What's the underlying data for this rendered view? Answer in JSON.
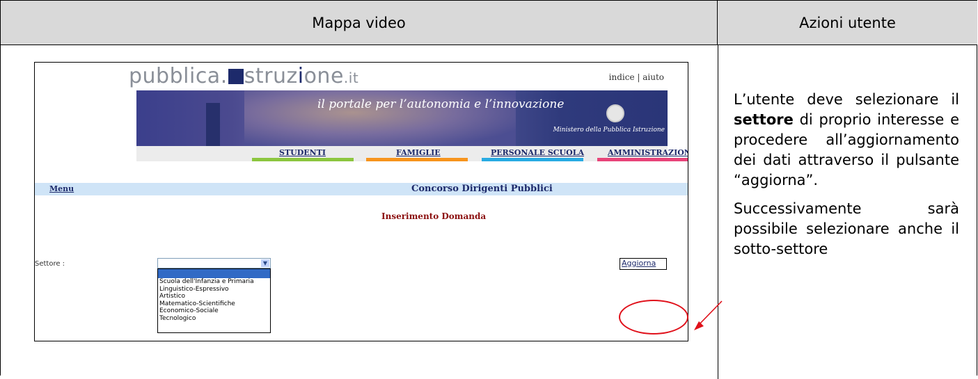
{
  "table": {
    "col_left_header": "Mappa video",
    "col_right_header": "Azioni utente"
  },
  "screen": {
    "logo_prefix": "pubblica.",
    "logo_mid": "struz",
    "logo_o": "i",
    "logo_end": "one",
    "logo_tld": ".it",
    "toplinks": "indice | aiuto",
    "tagline": "il portale per l’autonomia e l’innovazione",
    "ministero": "Ministero della Pubblica Istruzione",
    "nav": [
      "STUDENTI",
      "FAMIGLIE",
      "PERSONALE SCUOLA",
      "AMMINISTRAZIONE"
    ],
    "nav_colors": [
      "#8cc63f",
      "#f7941d",
      "#29abe2",
      "#e8457a"
    ],
    "menu_link": "Menu",
    "menu_title": "Concorso Dirigenti Pubblici",
    "subtitle": "Inserimento Domanda",
    "settore_label": "Settore :",
    "dropdown_options": [
      "Scuola dell'Infanzia e Primaria",
      "Linguistico-Espressivo",
      "Artistico",
      "Matematico-Scientifiche",
      "Economico-Sociale",
      "Tecnologico"
    ],
    "aggiorna_label": "Aggiorna"
  },
  "instructions": {
    "p1_pre": "L’utente deve selezionare il ",
    "p1_bold": "settore",
    "p1_post": " di proprio interesse e procedere all’aggiornamento dei dati attraverso il pulsante “aggiorna”.",
    "p2": "Successivamente sarà possibile selezionare anche il sotto-settore"
  },
  "colors": {
    "header_bg": "#d9d9d9",
    "highlight_red": "#e0101a",
    "site_navy": "#1d2a6b",
    "subtitle_red": "#8b0f0f",
    "menubar_bg": "#cfe4f7"
  }
}
